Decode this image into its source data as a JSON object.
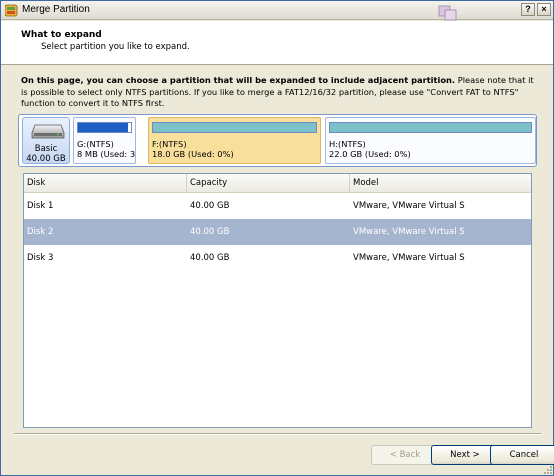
{
  "window": {
    "title": "Merge Partition",
    "help_label": "?",
    "close_label": "×"
  },
  "header": {
    "title": "What to expand",
    "subtitle": "Select partition you like to expand."
  },
  "description": {
    "bold": "On this page, you can choose a partition that will be expanded to include adjacent partition.",
    "rest": " Please note that it is possible to select only NTFS partitions. If you like to merge a FAT12/16/32 partition, please use \"Convert FAT to NTFS\" function to convert it to NTFS first."
  },
  "disk_map": {
    "disk": {
      "type": "Basic",
      "size": "40.00 GB",
      "icon": "hard-disk-icon"
    },
    "partitions": [
      {
        "name": "G:(NTFS)",
        "info": "8 MB (Used: 3",
        "used_fraction": 0.95,
        "bar_color": "#1d5fc4",
        "selected": false
      },
      {
        "name": "F:(NTFS)",
        "info": "18.0 GB (Used: 0%)",
        "used_fraction": 0.0,
        "bar_color": "#7cc1c9",
        "selected": true
      },
      {
        "name": "H:(NTFS)",
        "info": "22.0 GB (Used: 0%)",
        "used_fraction": 0.0,
        "bar_color": "#7cc1c9",
        "selected": false
      }
    ]
  },
  "table": {
    "columns": [
      "Disk",
      "Capacity",
      "Model"
    ],
    "rows": [
      {
        "disk": "Disk 1",
        "capacity": "40.00 GB",
        "model": "VMware, VMware Virtual S",
        "selected": false
      },
      {
        "disk": "Disk 2",
        "capacity": "40.00 GB",
        "model": "VMware, VMware Virtual S",
        "selected": true
      },
      {
        "disk": "Disk 3",
        "capacity": "40.00 GB",
        "model": "VMware, VMware Virtual S",
        "selected": false
      }
    ]
  },
  "buttons": {
    "back": "< Back",
    "next": "Next >",
    "cancel": "Cancel"
  },
  "colors": {
    "selected_row": "#a6b5cf",
    "selected_partition": "#f9df9c",
    "accent": "#1d5fc4"
  }
}
